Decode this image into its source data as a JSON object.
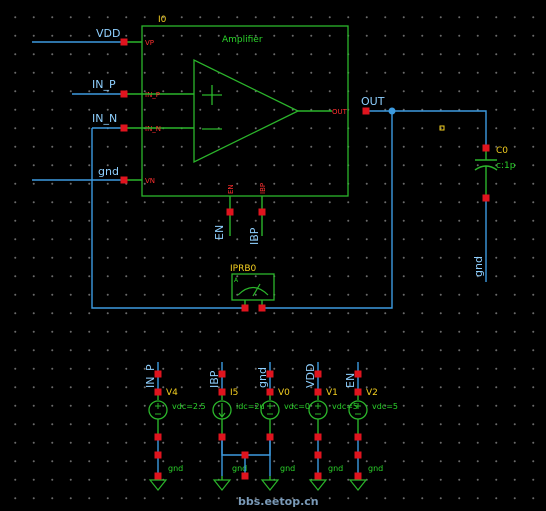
{
  "instance": {
    "name": "I0",
    "cell": "Amplifier"
  },
  "pins": {
    "vp": "VP",
    "inp": "IN_P",
    "inn": "IN_N",
    "vn": "VN",
    "out": "OUT",
    "en": "EN",
    "ibp": "IBP"
  },
  "nets": {
    "vdd": "VDD",
    "in_p": "IN_P",
    "in_n": "IN_N",
    "gnd": "gnd",
    "out": "OUT",
    "en": "EN",
    "ibp": "IBP"
  },
  "probe": {
    "name": "IPRB0",
    "unit": "A"
  },
  "cap": {
    "name": "C0",
    "value": "c:1p",
    "net": "gnd"
  },
  "sources": [
    {
      "net": "IN_P",
      "name": "V4",
      "value": "vdc=2.5",
      "gnd": "gnd"
    },
    {
      "net": "IBP",
      "name": "I5",
      "value": "idc=2u",
      "gnd": "gnd"
    },
    {
      "net": "gnd",
      "name": "V0",
      "value": "vdc=0",
      "gnd": "gnd"
    },
    {
      "net": "VDD",
      "name": "V1",
      "value": "vdc=5",
      "gnd": "gnd"
    },
    {
      "net": "EN",
      "name": "V2",
      "value": "vdc=5",
      "gnd": "gnd"
    }
  ],
  "watermark": "bbs.eetop.cn",
  "colors": {
    "wire": "#3d9be0",
    "symbol": "#2bb52b",
    "pin": "#e0141e",
    "label": "#8fd0ff",
    "instance": "#f5d020"
  }
}
